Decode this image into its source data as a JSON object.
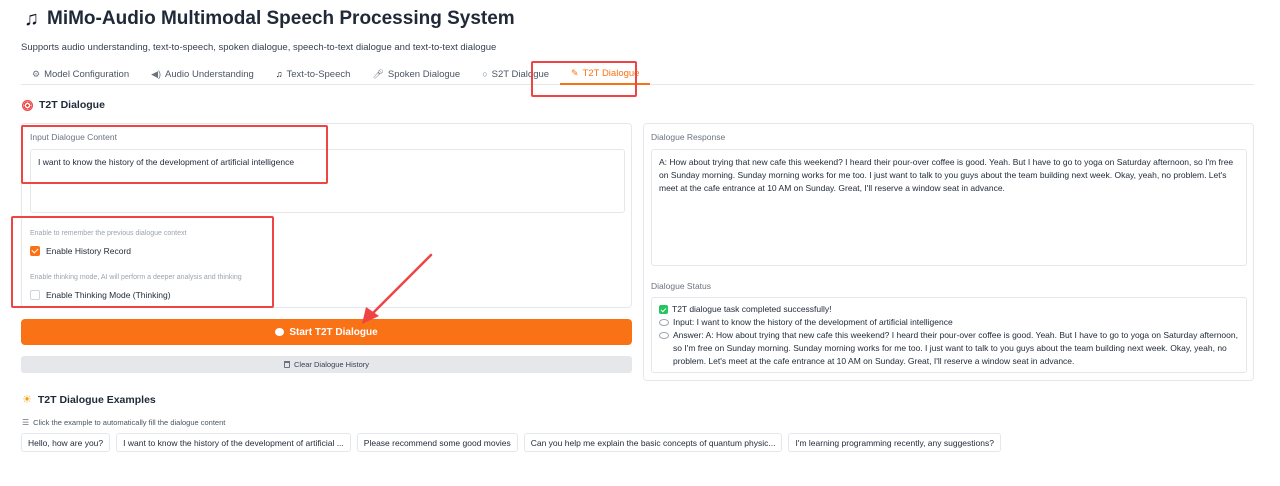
{
  "app": {
    "title": "MiMo-Audio Multimodal Speech Processing System",
    "subtitle": "Supports audio understanding, text-to-speech, spoken dialogue, speech-to-text dialogue and text-to-text dialogue",
    "title_icon": "music-note-icon"
  },
  "tabs": [
    {
      "label": "Model Configuration",
      "icon": "gear-icon",
      "active": false
    },
    {
      "label": "Audio Understanding",
      "icon": "speaker-icon",
      "active": false
    },
    {
      "label": "Text-to-Speech",
      "icon": "music-note-icon",
      "active": false
    },
    {
      "label": "Spoken Dialogue",
      "icon": "microphone-icon",
      "active": false
    },
    {
      "label": "S2T Dialogue",
      "icon": "speech-bubble-icon",
      "active": true
    },
    {
      "label": "T2T Dialogue",
      "icon": "memo-icon",
      "active": true
    }
  ],
  "section": {
    "title": "T2T Dialogue",
    "icon": "target-icon"
  },
  "input": {
    "label": "Input Dialogue Content",
    "value": "I want to know the history of the development of artificial intelligence"
  },
  "options": {
    "history_hint": "Enable to remember the previous dialogue context",
    "history_label": "Enable History Record",
    "history_checked": true,
    "thinking_hint": "Enable thinking mode, AI will perform a deeper analysis and thinking",
    "thinking_label": "Enable Thinking Mode (Thinking)",
    "thinking_checked": false
  },
  "buttons": {
    "start_label": "Start T2T Dialogue",
    "clear_label": "Clear Dialogue History"
  },
  "response": {
    "label": "Dialogue Response",
    "text": "A: How about trying that new cafe this weekend? I heard their pour-over coffee is good. Yeah. But I have to go to yoga on Saturday afternoon, so I'm free on Sunday morning. Sunday morning works for me too. I just want to talk to you guys about the team building next week. Okay, yeah, no problem. Let's meet at the cafe entrance at 10 AM on Sunday. Great, I'll reserve a window seat in advance."
  },
  "status": {
    "label": "Dialogue Status",
    "completed": "T2T dialogue task completed successfully!",
    "input_line": "Input: I want to know the history of the development of artificial intelligence",
    "answer_line": "Answer: A: How about trying that new cafe this weekend? I heard their pour-over coffee is good. Yeah. But I have to go to yoga on Saturday afternoon, so I'm free on Sunday morning. Sunday morning works for me too. I just want to talk to you guys about the team building next week. Okay, yeah, no problem. Let's meet at the cafe entrance at 10 AM on Sunday. Great, I'll reserve a window seat in advance."
  },
  "examples": {
    "title": "T2T Dialogue Examples",
    "hint": "Click the example to automatically fill the dialogue content",
    "items": [
      "Hello, how are you?",
      "I want to know the history of the development of artificial ...",
      "Please recommend some good movies",
      "Can you help me explain the basic concepts of quantum physic...",
      "I'm learning programming recently, any suggestions?"
    ]
  },
  "colors": {
    "accent": "#f97316",
    "highlight": "#ef4444",
    "success": "#22c55e"
  }
}
